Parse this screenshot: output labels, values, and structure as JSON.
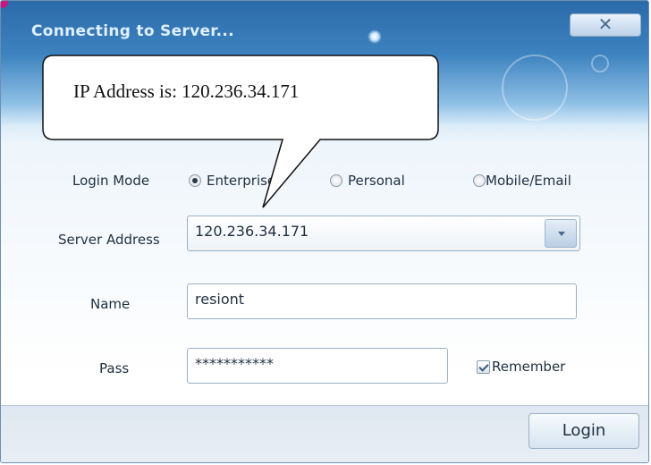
{
  "window": {
    "title": "Connecting to Server...",
    "close_glyph": "✕"
  },
  "form": {
    "login_mode_label": "Login Mode",
    "login_modes": [
      {
        "label": "Enterprise",
        "selected": true
      },
      {
        "label": "Personal",
        "selected": false
      },
      {
        "label": "Mobile/Email",
        "selected": false
      }
    ],
    "server_label": "Server Address",
    "server_value": "120.236.34.171",
    "name_label": "Name",
    "name_value": "resiont",
    "pass_label": "Pass",
    "pass_value": "***********",
    "remember_label": "Remember",
    "remember_checked": true
  },
  "footer": {
    "login_label": "Login"
  },
  "callout": {
    "text": "IP Address is: 120.236.34.171"
  },
  "colors": {
    "title_bar": "#2b6aa8",
    "accent_pink": "#d0147e"
  }
}
